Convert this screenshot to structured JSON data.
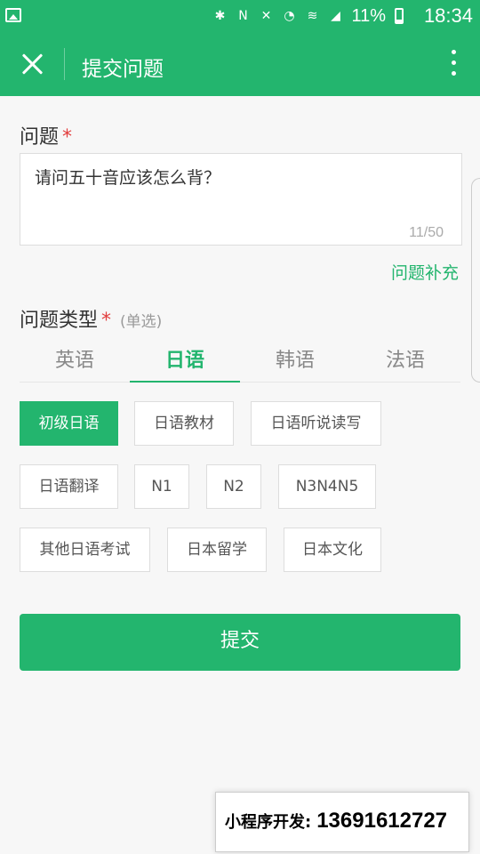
{
  "status_bar": {
    "battery": "11%",
    "time": "18:34",
    "icons": [
      "image-icon",
      "bluetooth-icon",
      "nfc-icon",
      "mute-icon",
      "alarm-icon",
      "wifi-icon",
      "4g-signal-icon",
      "battery-icon"
    ]
  },
  "nav": {
    "title": "提交问题"
  },
  "question": {
    "label": "问题",
    "required_mark": "*",
    "value": "请问五十音应该怎么背？",
    "count": "11/50",
    "supplement_link": "问题补充"
  },
  "question_type": {
    "label": "问题类型",
    "required_mark": "*",
    "hint": "(单选)",
    "tabs": [
      "英语",
      "日语",
      "韩语",
      "法语"
    ],
    "active_tab": "日语",
    "options": [
      "初级日语",
      "日语教材",
      "日语听说读写",
      "日语翻译",
      "N1",
      "N2",
      "N3N4N5",
      "其他日语考试",
      "日本留学",
      "日本文化"
    ],
    "selected_option": "初级日语"
  },
  "submit_label": "提交",
  "watermark": {
    "label": "小程序开发:",
    "phone": "13691612727"
  },
  "colors": {
    "brand_green": "#23b56e",
    "required_red": "#e23d3d"
  }
}
